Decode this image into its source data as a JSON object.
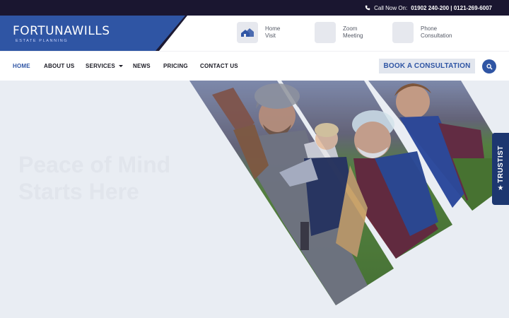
{
  "topbar": {
    "call_prefix": "Call Now On:",
    "phones": "01902 240-200 | 0121-269-6007"
  },
  "logo": {
    "name": "FORTUNAWILLS",
    "tagline": "ESTATE PLANNING"
  },
  "contact_options": [
    {
      "line1": "Home",
      "line2": "Visit",
      "icon": "house-icon"
    },
    {
      "line1": "Zoom",
      "line2": "Meeting",
      "icon": "video-icon"
    },
    {
      "line1": "Phone",
      "line2": "Consultation",
      "icon": "phone-icon"
    }
  ],
  "nav": {
    "home": "HOME",
    "about": "ABOUT US",
    "services": "SERVICES",
    "news": "NEWS",
    "pricing": "PRICING",
    "contact": "CONTACT US",
    "book": "BOOK A CONSULTATION"
  },
  "hero": {
    "line1": "Peace of Mind",
    "line2": "Starts Here"
  },
  "trustist": {
    "label": "TRUSTIST"
  },
  "colors": {
    "brand_blue": "#2f55a4",
    "topbar": "#1a1630",
    "hero_bg": "#e9edf3"
  }
}
